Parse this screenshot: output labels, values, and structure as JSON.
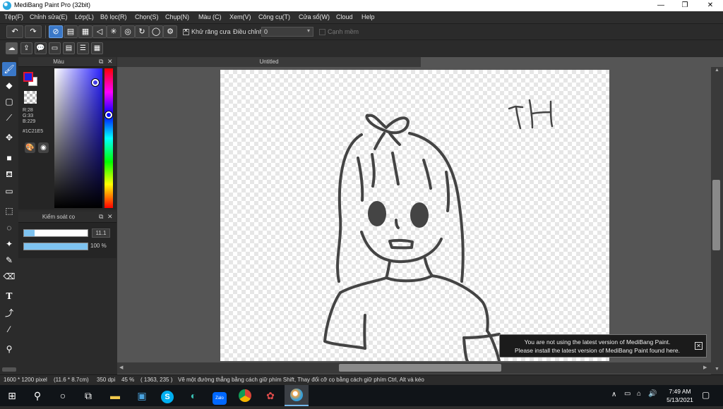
{
  "window": {
    "title": "MediBang Paint Pro (32bit)"
  },
  "menu": [
    "Tệp(F)",
    "Chỉnh sửa(E)",
    "Lớp(L)",
    "Bộ lọc(R)",
    "Chọn(S)",
    "Chụp(N)",
    "Màu (C)",
    "Xem(V)",
    "Công cụ(T)",
    "Cửa sổ(W)",
    "Cloud",
    "Help"
  ],
  "toolbar": {
    "antialias_label": "Khử răng cưa",
    "adjust_label": "Điều chỉnh",
    "adjust_value": "0",
    "smooth_label": "Cạnh mềm"
  },
  "color_panel": {
    "title": "Màu",
    "r": "R:28",
    "g": "G:33",
    "b": "B:229",
    "hex": "#1C21E5",
    "primary": "#1c21e5"
  },
  "brush_panel": {
    "title": "Kiểm soát cọ",
    "size_value": "11.1",
    "opacity_value": "100 %",
    "size_fraction": 0.17,
    "opacity_fraction": 1.0
  },
  "document": {
    "tab_title": "Untitled",
    "drawing_text": "TH"
  },
  "notification": {
    "line1": "You are not using the latest version of MediBang Paint.",
    "line2": "Please install the latest version of MediBang Paint found here."
  },
  "status": {
    "size": "1600 * 1200 pixel",
    "dims": "(11.6 * 8.7cm)",
    "dpi": "350 dpi",
    "zoom": "45 %",
    "coords": "( 1363, 235 )",
    "hint": "Vẽ một đường thẳng bằng cách giữ phím Shift, Thay đổi cỡ cọ bằng cách giữ phím Ctrl, Alt và kéo"
  },
  "taskbar": {
    "time": "7:49 AM",
    "date": "5/13/2021"
  }
}
